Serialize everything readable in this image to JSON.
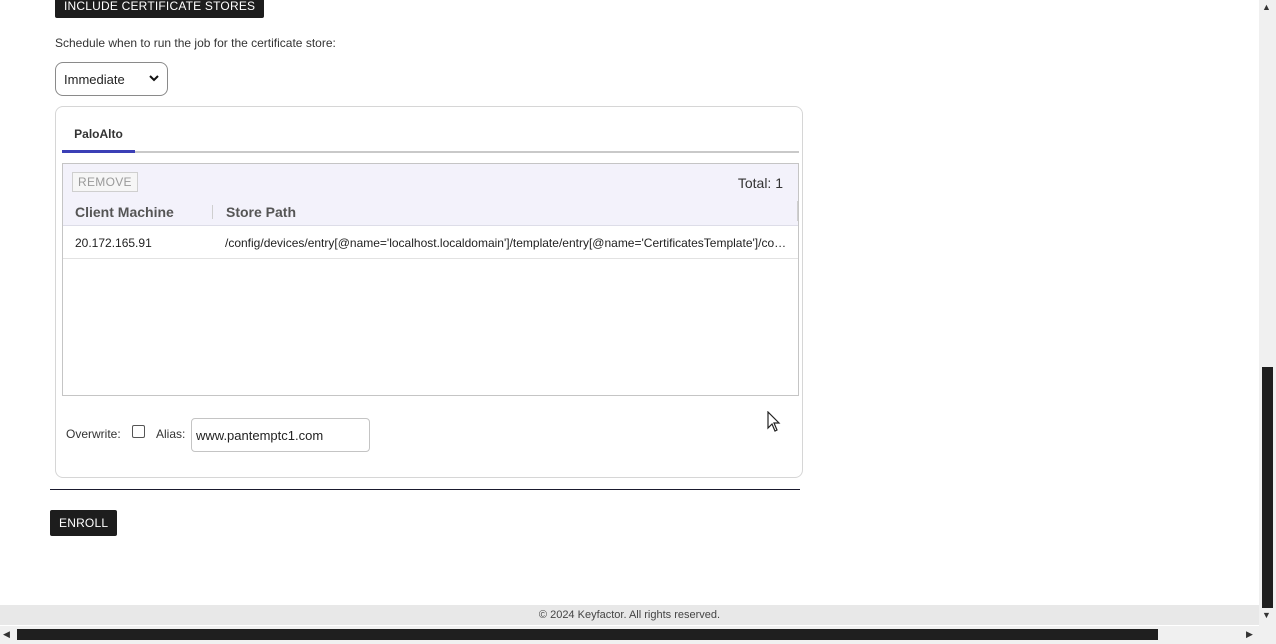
{
  "include_button": {
    "label": "INCLUDE CERTIFICATE STORES"
  },
  "schedule": {
    "label": "Schedule when to run the job for the certificate store:",
    "selected": "Immediate"
  },
  "tabs": [
    {
      "label": "PaloAlto",
      "active": true
    }
  ],
  "grid": {
    "remove_label": "REMOVE",
    "total_label": "Total: 1",
    "columns": [
      "Client Machine",
      "Store Path"
    ],
    "rows": [
      {
        "client_machine": "20.172.165.91",
        "store_path": "/config/devices/entry[@name='localhost.localdomain']/template/entry[@name='CertificatesTemplate']/config/shared/certificate"
      }
    ]
  },
  "options": {
    "overwrite_label": "Overwrite:",
    "overwrite_checked": false,
    "alias_label": "Alias:",
    "alias_value": "www.pantemptc1.com"
  },
  "enroll_button": {
    "label": "ENROLL"
  },
  "footer": {
    "text": "© 2024 Keyfactor. All rights reserved."
  },
  "icons": {
    "select_chevron": "chevron-down-icon",
    "scroll_up": "arrow-up-icon",
    "scroll_down": "arrow-down-icon",
    "scroll_left": "arrow-left-icon",
    "scroll_right": "arrow-right-icon"
  },
  "colors": {
    "accent": "#3b3fb6",
    "dark_button": "#1d1d1d",
    "grid_header": "#f3f2fb"
  }
}
